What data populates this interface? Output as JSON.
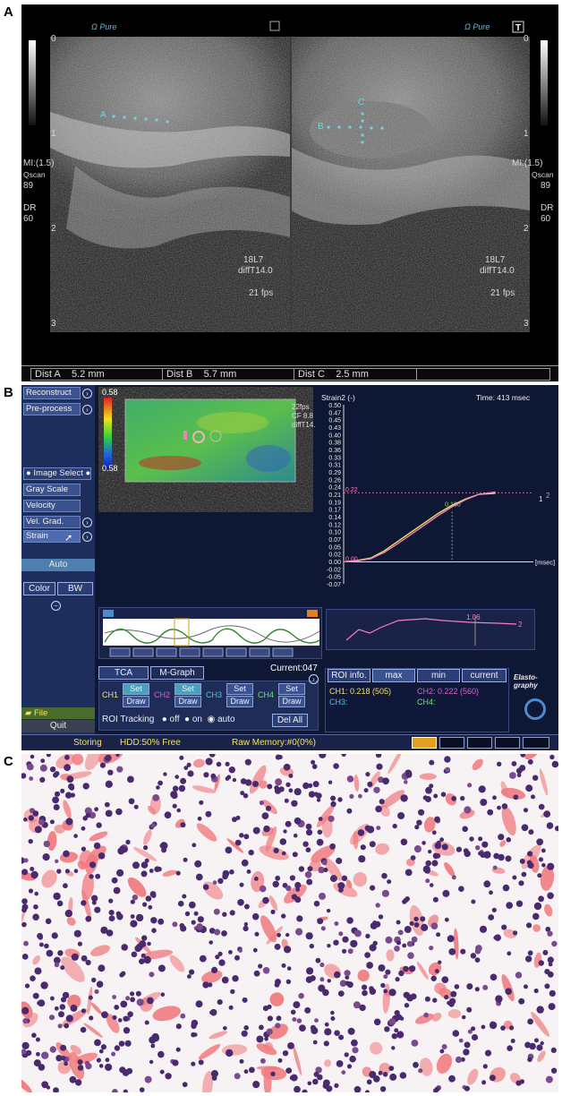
{
  "panel_labels": {
    "a": "A",
    "b": "B",
    "c": "C"
  },
  "ultrasound": {
    "left": {
      "depth_ticks": [
        "0",
        "1",
        "2",
        "3"
      ],
      "mi": "MI:(1.5)",
      "qscan": "Qscan",
      "qscan_val": "89",
      "dr": "DR",
      "dr_val": "60",
      "probe": "18L7",
      "diff": "diffT14.0",
      "fps": "21 fps",
      "marker": "A"
    },
    "right": {
      "depth_ticks": [
        "0",
        "1",
        "2",
        "3"
      ],
      "mi": "MI:(1.5)",
      "qscan": "Qscan",
      "qscan_val": "89",
      "dr": "DR",
      "dr_val": "60",
      "probe": "18L7",
      "diff": "diffT14.0",
      "fps": "21 fps",
      "marker_b": "B",
      "marker_c": "C"
    },
    "measurements": [
      {
        "label": "Dist A",
        "value": "5.2",
        "unit": "mm"
      },
      {
        "label": "Dist B",
        "value": "5.7",
        "unit": "mm"
      },
      {
        "label": "Dist C",
        "value": "2.5",
        "unit": "mm"
      }
    ]
  },
  "elastography": {
    "sidebar": {
      "reconstruct": "Reconstruct",
      "preprocess": "Pre-process",
      "image_select": "Image Select",
      "gray_scale": "Gray Scale",
      "velocity": "Velocity",
      "vel_grad": "Vel. Grad.",
      "strain": "Strain",
      "auto": "Auto",
      "color": "Color",
      "bw": "BW",
      "file": "File",
      "quit": "Quit"
    },
    "colorbar": {
      "top": "0.58",
      "bottom": "0.58"
    },
    "image_text": {
      "fps": "22fps",
      "cf": "CF 8.8",
      "diff": "diffT14."
    },
    "strain_chart_title": "Strain2 (-)",
    "time": "Time: 413 msec",
    "tca_tab": "TCA",
    "mgraph_tab": "M-Graph",
    "current": "Current:047",
    "channels": [
      {
        "label": "CH1",
        "set": "Set",
        "draw": "Draw",
        "color": "#f3e35a"
      },
      {
        "label": "CH2",
        "set": "Set",
        "draw": "Draw",
        "color": "#e05ad0"
      },
      {
        "label": "CH3",
        "set": "Set",
        "draw": "Draw",
        "color": "#4ec3e0"
      },
      {
        "label": "CH4",
        "set": "Set",
        "draw": "Draw",
        "color": "#6fe36a"
      }
    ],
    "roi_tracking": "ROI Tracking",
    "roi_off": "off",
    "roi_on": "on",
    "roi_auto": "auto",
    "del_all": "Del All",
    "roi_tabs": [
      "ROI info.",
      "max",
      "min",
      "current"
    ],
    "ch1_val": "CH1: 0.218 (505)",
    "ch2_val": "CH2: 0.222 (560)",
    "ch3_val": "CH3:",
    "ch4_val": "CH4:",
    "elasto_logo": "Elasto-graphy",
    "mini_value": "1.06",
    "mini_series": "2",
    "status": {
      "storing": "Storing",
      "hdd": "HDD:50% Free",
      "raw": "Raw Memory:#0(0%)"
    },
    "colors": {
      "sidebar": "#1d2d5c",
      "accent": "#f3e35a"
    }
  },
  "chart_data": {
    "type": "line",
    "title": "Strain2 (-)",
    "xlabel": "[msec]",
    "ylabel": "",
    "ylim": [
      -0.07,
      0.5
    ],
    "y_ticks": [
      "0.50",
      "0.47",
      "0.45",
      "0.43",
      "0.40",
      "0.38",
      "0.36",
      "0.33",
      "0.31",
      "0.29",
      "0.26",
      "0.24",
      "0.21",
      "0.19",
      "0.17",
      "0.14",
      "0.12",
      "0.10",
      "0.07",
      "0.05",
      "0.02",
      "0.00",
      "-0.02",
      "-0.05",
      "-0.07"
    ],
    "grid": false,
    "annotations": {
      "ref_top": "0.22",
      "ref_bottom": "0.00",
      "mid": "0.160",
      "end_1": "1",
      "end_2": "2"
    },
    "series": [
      {
        "name": "1",
        "color": "#f3e35a",
        "x": [
          0,
          50,
          100,
          150,
          200,
          250,
          300,
          350,
          400,
          450,
          500,
          560
        ],
        "values": [
          0.0,
          0.004,
          0.012,
          0.035,
          0.065,
          0.095,
          0.125,
          0.155,
          0.18,
          0.2,
          0.215,
          0.218
        ]
      },
      {
        "name": "2",
        "color": "#f080c0",
        "x": [
          0,
          50,
          100,
          150,
          200,
          250,
          300,
          350,
          400,
          450,
          500,
          560
        ],
        "values": [
          0.0,
          0.003,
          0.01,
          0.03,
          0.058,
          0.088,
          0.118,
          0.148,
          0.175,
          0.198,
          0.215,
          0.222
        ]
      }
    ]
  }
}
